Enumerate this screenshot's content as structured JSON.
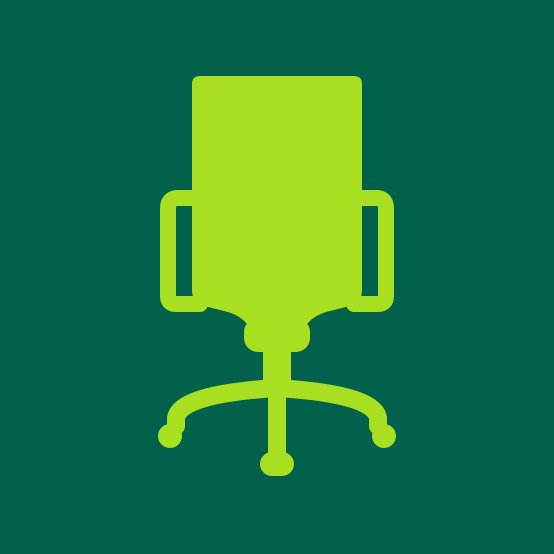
{
  "colors": {
    "background": "#02614A",
    "icon": "#A8E021"
  },
  "icon": {
    "name": "office-chair-icon"
  }
}
